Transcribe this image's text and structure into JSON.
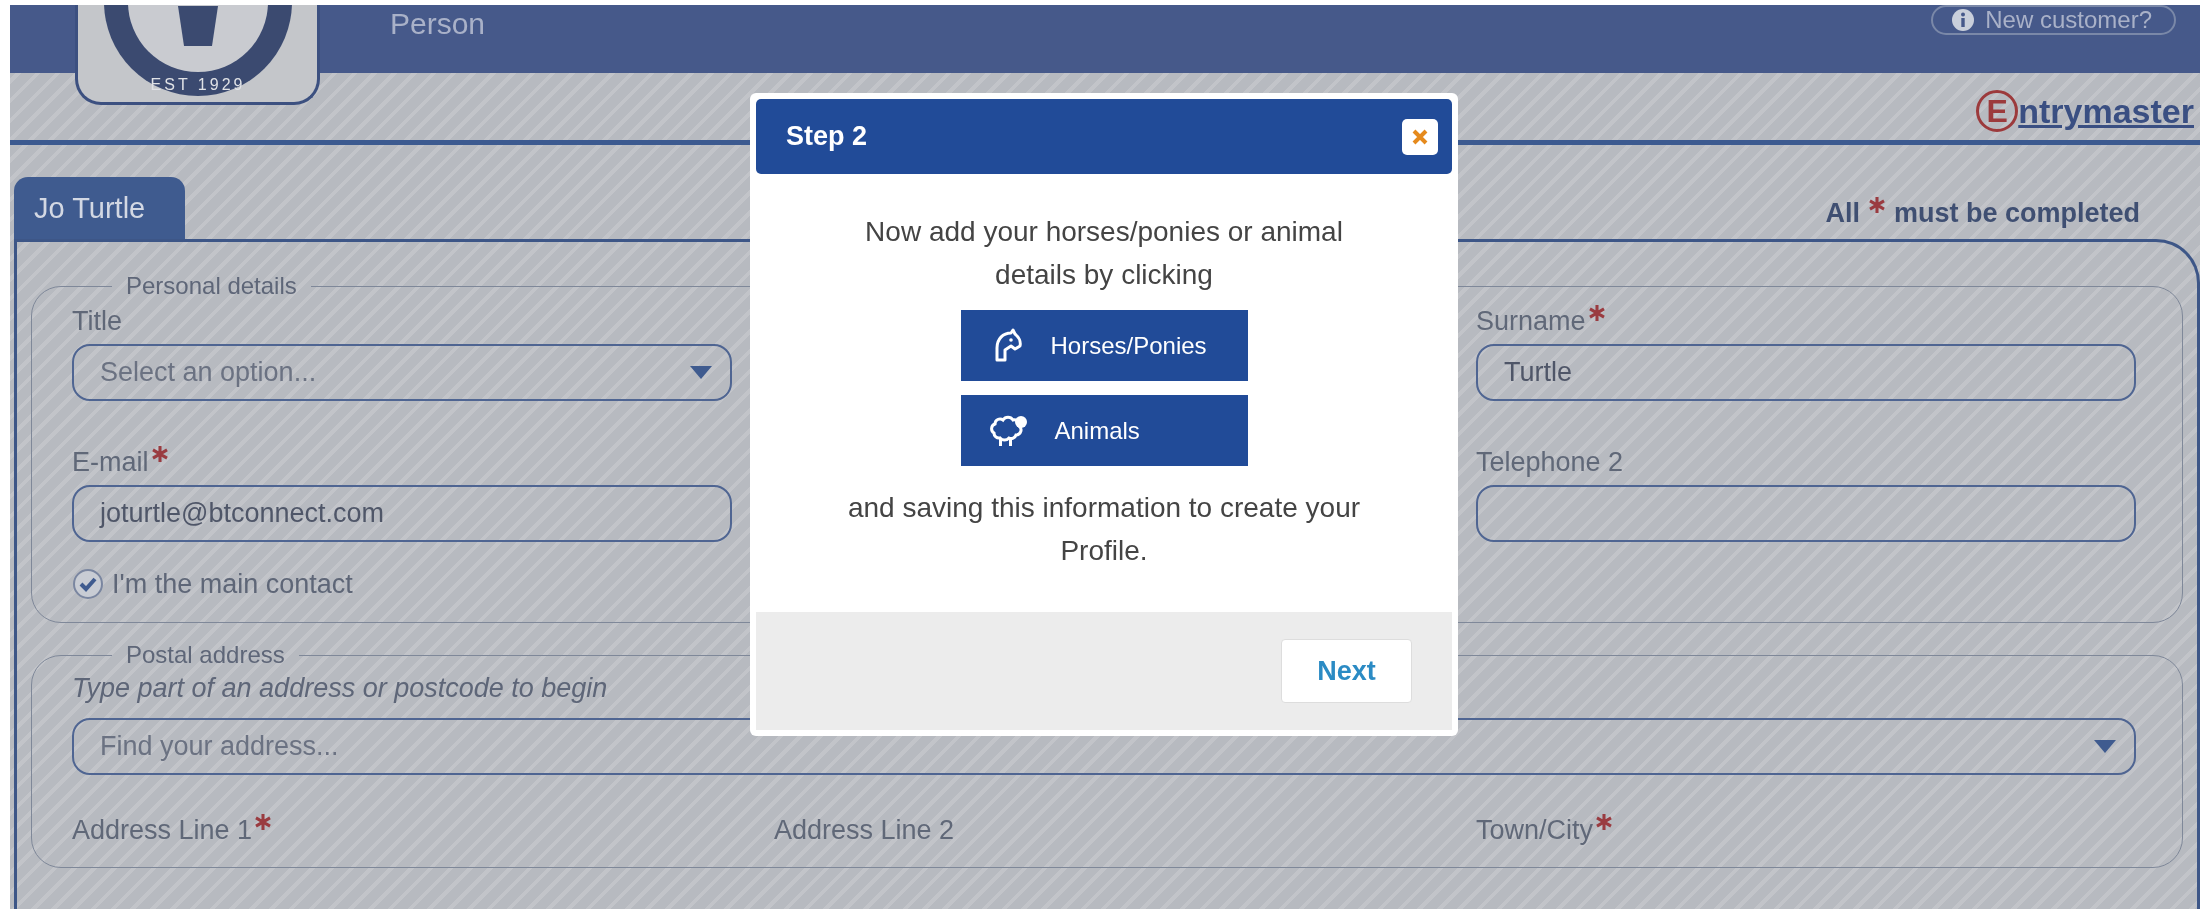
{
  "header": {
    "logo_text": "EST 1929",
    "page_title": "Person",
    "new_customer": "New customer?",
    "brand": {
      "initial": "E",
      "rest": "ntrymaster"
    }
  },
  "tabs": [
    {
      "label": "Jo Turtle",
      "selected": true
    }
  ],
  "required_note": {
    "before": "All",
    "after": "must be completed"
  },
  "personal": {
    "legend": "Personal details",
    "rows": [
      {
        "left": {
          "kind": "select",
          "label": "Title",
          "required": false,
          "placeholder": "Select an option..."
        },
        "right": {
          "kind": "text",
          "label": "Surname",
          "required": true,
          "value": "Turtle"
        }
      },
      {
        "left": {
          "kind": "text",
          "label": "E-mail",
          "required": true,
          "value": "joturtle@btconnect.com"
        },
        "right": {
          "kind": "text",
          "label": "Telephone 2",
          "required": false
        }
      }
    ],
    "main_contact": {
      "label": "I'm the main contact",
      "checked": true
    }
  },
  "postal": {
    "legend": "Postal address",
    "hint": "Type part of an address or postcode to begin",
    "finder": {
      "kind": "select",
      "placeholder": "Find your address..."
    },
    "labels": [
      {
        "label": "Address Line 1",
        "required": true
      },
      {
        "label": "Address Line 2",
        "required": false
      },
      {
        "label": "Town/City",
        "required": true
      }
    ]
  },
  "modal": {
    "title": "Step 2",
    "intro": "Now add your horses/ponies or animal details by clicking",
    "buttons": [
      {
        "kind": "horse",
        "label": "Horses/Ponies"
      },
      {
        "kind": "animal",
        "label": "Animals"
      }
    ],
    "outro": "and saving this information to create your Profile.",
    "next": "Next"
  }
}
